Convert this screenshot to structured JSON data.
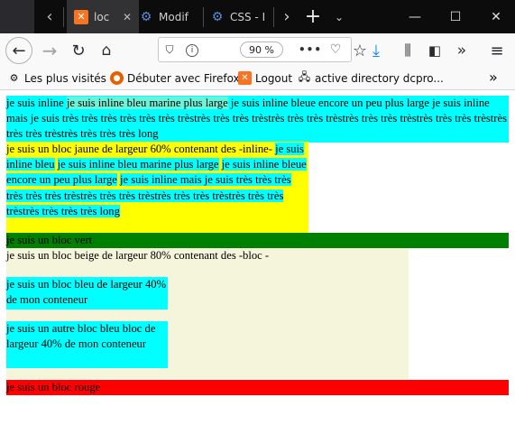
{
  "tabs": [
    {
      "label": "loc",
      "active": true
    },
    {
      "label": "Modif",
      "active": false
    },
    {
      "label": "CSS - I",
      "active": false
    }
  ],
  "window_controls": [
    "—",
    "☐",
    "✕"
  ],
  "toolbar": {
    "zoom": "90 %"
  },
  "bookmarks": [
    {
      "label": "Les plus visités",
      "icon": "gear-icon"
    },
    {
      "label": "Débuter avec Firefox",
      "icon": "firefox-icon"
    },
    {
      "label": "Logout",
      "icon": "xampp-icon"
    },
    {
      "label": "active directory dcpro...",
      "icon": "ad-icon"
    }
  ],
  "page": {
    "p1": {
      "inline1": "je suis inline",
      "inline2": "je suis inline bleu marine plus large",
      "inline3": "je suis inline bleue encore un peu plus large",
      "inline4": "je suis inline mais je suis très très très très très très trèstrès très très trèstrès très très trèstrès très très trèstrès très très trèstrès très très trèstrès très très très long"
    },
    "yellow": {
      "text": "je suis un bloc jaune de largeur 60% contenant des -inline-",
      "inline1": "je suis inline bleu",
      "inline2": "je suis inline bleu marine plus large",
      "inline3": "je suis inline bleue encore un peu plus large",
      "inline4": "je suis inline mais je suis très très très très très très trèstrès très très trèstrès très très trèstrès très très trèstrès très très très long"
    },
    "green": "je suis un bloc vert",
    "beige": {
      "text": "je suis un bloc beige de largeur 80% contenant des -bloc -",
      "blue1": "je suis un bloc bleu de largeur 40% de mon conteneur",
      "blue2": "je suis un autre bloc bleu bloc de largeur 40% de mon conteneur"
    },
    "red": "je suis un bloc rouge"
  }
}
